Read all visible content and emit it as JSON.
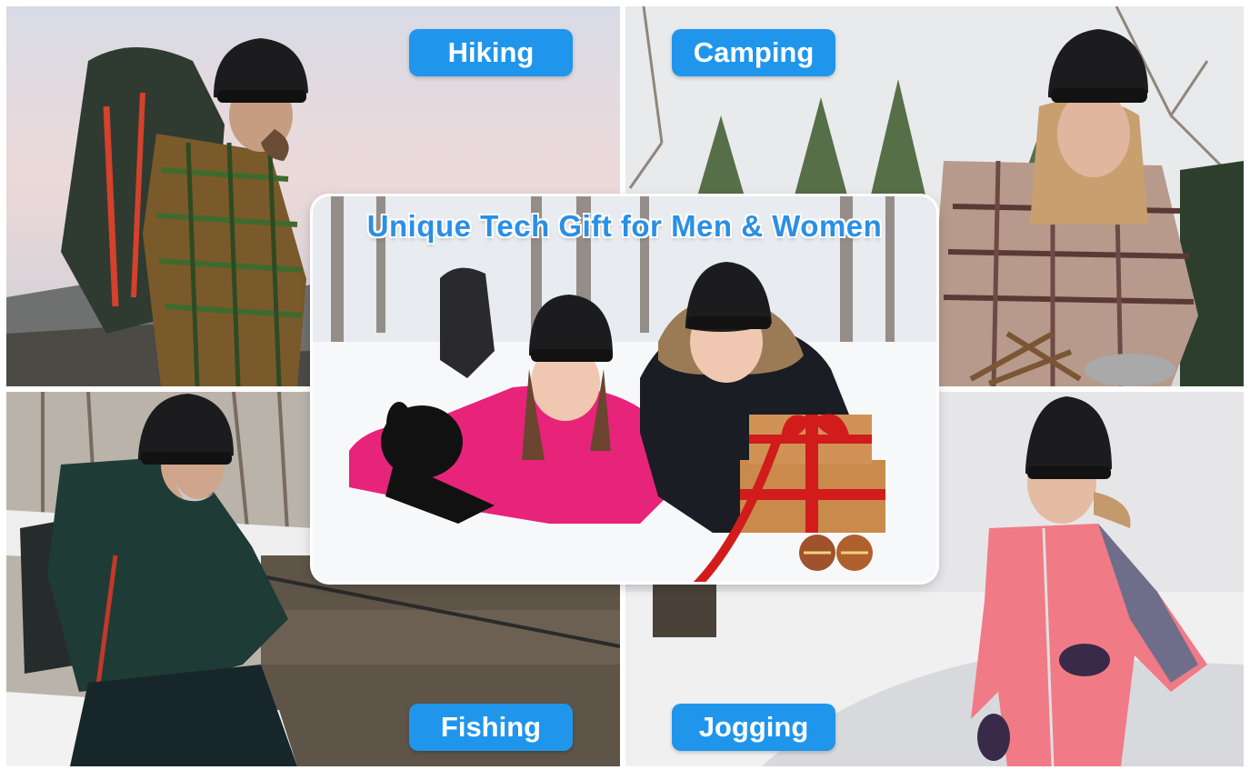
{
  "headline": "Unique Tech Gift for Men & Women",
  "activities": {
    "hiking": "Hiking",
    "camping": "Camping",
    "fishing": "Fishing",
    "jogging": "Jogging"
  },
  "colors": {
    "label_blue": "#1f96ec",
    "headline_blue": "#2a8fe6",
    "beanie_black": "#1c1c1e",
    "snow_white": "#f4f6f9"
  },
  "icons": {
    "hiker": "hiker-photo",
    "camper": "camper-photo",
    "fisherman": "fisherman-photo",
    "jogger": "jogger-photo",
    "couple": "couple-in-snow-photo",
    "gift": "gift-box-icon"
  }
}
